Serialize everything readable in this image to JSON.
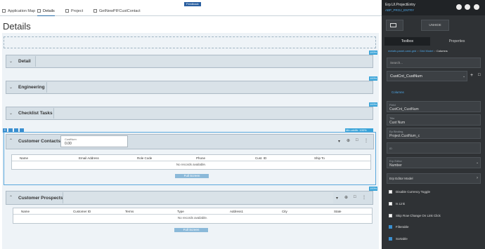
{
  "feedback": "Feedback",
  "tabs": [
    {
      "label": "Application Map"
    },
    {
      "label": "Details"
    },
    {
      "label": "Project"
    },
    {
      "label": "GetNewPIFCustContact"
    }
  ],
  "page_title": "Details",
  "pct": "100%",
  "panels": {
    "detail": "Detail",
    "engineering": "Engineering",
    "checklist": "Checklist Tasks",
    "contacts": "Customer Contacts",
    "prospects": "Customer Prospects"
  },
  "minwidth": "Min-width: 100%",
  "custnum_field": {
    "label": "CustNum",
    "value": "0.00"
  },
  "contacts_grid": {
    "columns": [
      "Name",
      "Email Address",
      "Role Code",
      "Phone",
      "Cust. ID",
      "Ship To"
    ],
    "empty": "No records available.",
    "fullscreen": "Full Screen"
  },
  "prospects_grid": {
    "columns": [
      "Name",
      "Customer ID",
      "Terms",
      "Type",
      "Address1",
      "City",
      "State"
    ],
    "empty": "No records available.",
    "fullscreen": "Full Screen"
  },
  "right_panel": {
    "app_title": "Erp.UI.ProjectEntry",
    "app_subtitle": "ABP_PROJ_ENTRY",
    "unhide": "UNHIDE",
    "tab_toolbox": "Toolbox",
    "tab_properties": "Properties",
    "breadcrumb_link": "metafx-panel-card-grid",
    "breadcrumb_mid": "Grid Model",
    "breadcrumb_current": "Columns",
    "search_placeholder": "Search...",
    "column_select": "CustCnt_CustNum",
    "section": "Columns",
    "field_label": "Field",
    "field_value": "CustCnt_CustNum",
    "title_label": "Title",
    "title_value": "Cust Num",
    "binding_label": "Ep Binding",
    "binding_value": "Project.CustNum_c",
    "id_label": "ID",
    "id_value": "",
    "editor_label": "Erp Editor",
    "editor_value": "Number",
    "editor_model": "Erp Editor Model",
    "checks": [
      {
        "label": "Disable Currency Toggle",
        "checked": false
      },
      {
        "label": "Is Link",
        "checked": false
      },
      {
        "label": "Skip Row Change On Link Click",
        "checked": false
      },
      {
        "label": "Filterable",
        "checked": true
      },
      {
        "label": "Sortable",
        "checked": true
      }
    ]
  }
}
